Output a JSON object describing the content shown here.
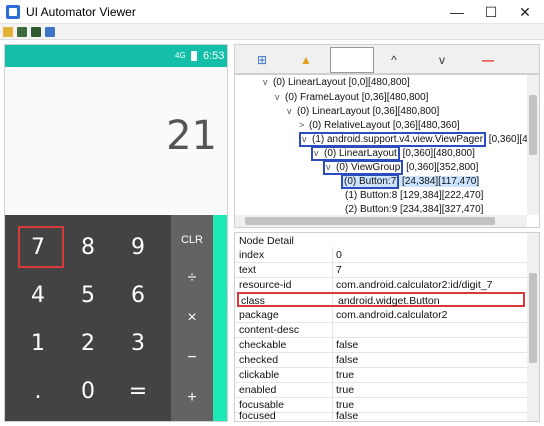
{
  "window": {
    "title": "UI Automator Viewer",
    "minimize": "—",
    "maximize": "☐",
    "close": "✕"
  },
  "toolbar": {
    "icons": [
      "open-folder-icon",
      "device-screenshot-icon",
      "device-screenshot-compressed-icon",
      "save-icon"
    ]
  },
  "device": {
    "status": {
      "signal": "4G",
      "time": "6:53"
    },
    "result": "21",
    "keys": [
      {
        "label": "7",
        "name": "key-7"
      },
      {
        "label": "8",
        "name": "key-8"
      },
      {
        "label": "9",
        "name": "key-9"
      },
      {
        "label": "4",
        "name": "key-4"
      },
      {
        "label": "5",
        "name": "key-5"
      },
      {
        "label": "6",
        "name": "key-6"
      },
      {
        "label": "1",
        "name": "key-1"
      },
      {
        "label": "2",
        "name": "key-2"
      },
      {
        "label": "3",
        "name": "key-3"
      },
      {
        "label": ".",
        "name": "key-dot"
      },
      {
        "label": "0",
        "name": "key-0"
      },
      {
        "label": "=",
        "name": "key-equals"
      }
    ],
    "ops": [
      {
        "label": "CLR",
        "name": "op-clr"
      },
      {
        "label": "÷",
        "name": "op-divide"
      },
      {
        "label": "×",
        "name": "op-multiply"
      },
      {
        "label": "−",
        "name": "op-minus"
      },
      {
        "label": "+",
        "name": "op-plus"
      }
    ]
  },
  "right_toolbar": {
    "expand_icon": "⊞",
    "warning_icon": "▲",
    "up_icon": "^",
    "down_icon": "v",
    "remove_icon": "—"
  },
  "tree": {
    "nodes": [
      {
        "arrow": "v",
        "label": "(0) LinearLayout [0,0][480,800]"
      },
      {
        "arrow": "v",
        "label": "(0) FrameLayout [0,36][480,800]"
      },
      {
        "arrow": "v",
        "label": "(0) LinearLayout [0,36][480,800]"
      },
      {
        "arrow": ">",
        "label": "(0) RelativeLayout [0,36][480,360]"
      },
      {
        "arrow": "v",
        "label": "(1) android.support.v4.view.ViewPager",
        "suffix": " [0,360][4"
      },
      {
        "arrow": "v",
        "label": "(0) LinearLayout",
        "suffix": " [0,360][480,800]"
      },
      {
        "arrow": "v",
        "label": "(0) ViewGroup",
        "suffix": " [0,360][352,800]"
      },
      {
        "arrow": "",
        "label": "(0) Button:7",
        "suffix": " [24,384][117,470]"
      },
      {
        "arrow": "",
        "label": "(1) Button:8 [129,384][222,470]"
      },
      {
        "arrow": "",
        "label": "(2) Button:9 [234,384][327,470]"
      }
    ]
  },
  "detail": {
    "title": "Node Detail",
    "rows": [
      {
        "key": "index",
        "value": "0"
      },
      {
        "key": "text",
        "value": "7"
      },
      {
        "key": "resource-id",
        "value": "com.android.calculator2:id/digit_7"
      },
      {
        "key": "class",
        "value": "android.widget.Button"
      },
      {
        "key": "package",
        "value": "com.android.calculator2"
      },
      {
        "key": "content-desc",
        "value": ""
      },
      {
        "key": "checkable",
        "value": "false"
      },
      {
        "key": "checked",
        "value": "false"
      },
      {
        "key": "clickable",
        "value": "true"
      },
      {
        "key": "enabled",
        "value": "true"
      },
      {
        "key": "focusable",
        "value": "true"
      },
      {
        "key": "focused",
        "value": "false"
      }
    ]
  }
}
